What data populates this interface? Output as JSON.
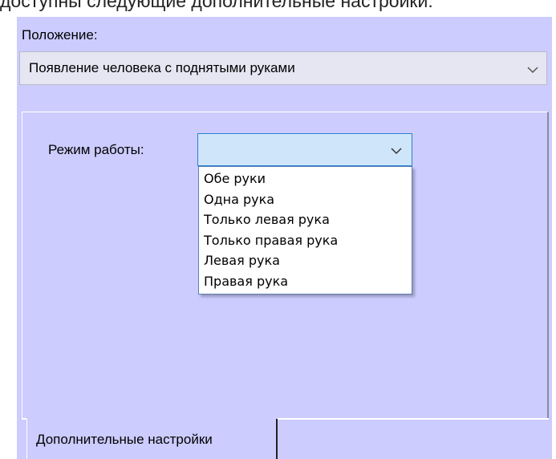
{
  "caption": "доступны следующие дополнительные настройки:",
  "position": {
    "label": "Положение:",
    "selected": "Появление человека с поднятыми руками"
  },
  "mode": {
    "label": "Режим работы:",
    "selected": "",
    "options": [
      "Обе руки",
      "Одна рука",
      "Только левая рука",
      "Только правая рука",
      "Левая рука",
      "Правая рука"
    ]
  },
  "tab": {
    "label": "Дополнительные настройки"
  },
  "colors": {
    "panel": "#ccccff",
    "combo_focus": "#cfe6fa",
    "focus_border": "#2b7fd2"
  },
  "icons": {
    "combo_arrow": "chevron-down-icon"
  }
}
